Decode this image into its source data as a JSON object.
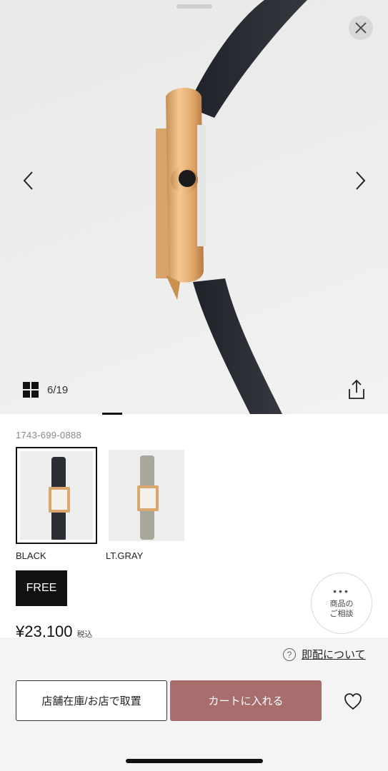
{
  "gallery": {
    "counter": "6/19",
    "background_color": "#ebebeb",
    "icons": {
      "close": "close-icon",
      "prev": "chevron-left-icon",
      "next": "chevron-right-icon",
      "grid": "grid-icon",
      "share": "share-icon"
    }
  },
  "product": {
    "code": "1743-699-0888",
    "colors": [
      {
        "label": "BLACK",
        "strap_color": "#2a2d33",
        "selected": true
      },
      {
        "label": "LT.GRAY",
        "strap_color": "#a9a79c",
        "selected": false
      }
    ],
    "size": "FREE",
    "consult": {
      "dots": "•••",
      "label": "商品の\nご相談"
    },
    "price": "¥23,100",
    "tax_label": "税込"
  },
  "actions": {
    "delivery_link": "即配について",
    "store_button": "店舗在庫/お店で取置",
    "cart_button": "カートに入れる",
    "accent_color": "#a86e6e"
  }
}
